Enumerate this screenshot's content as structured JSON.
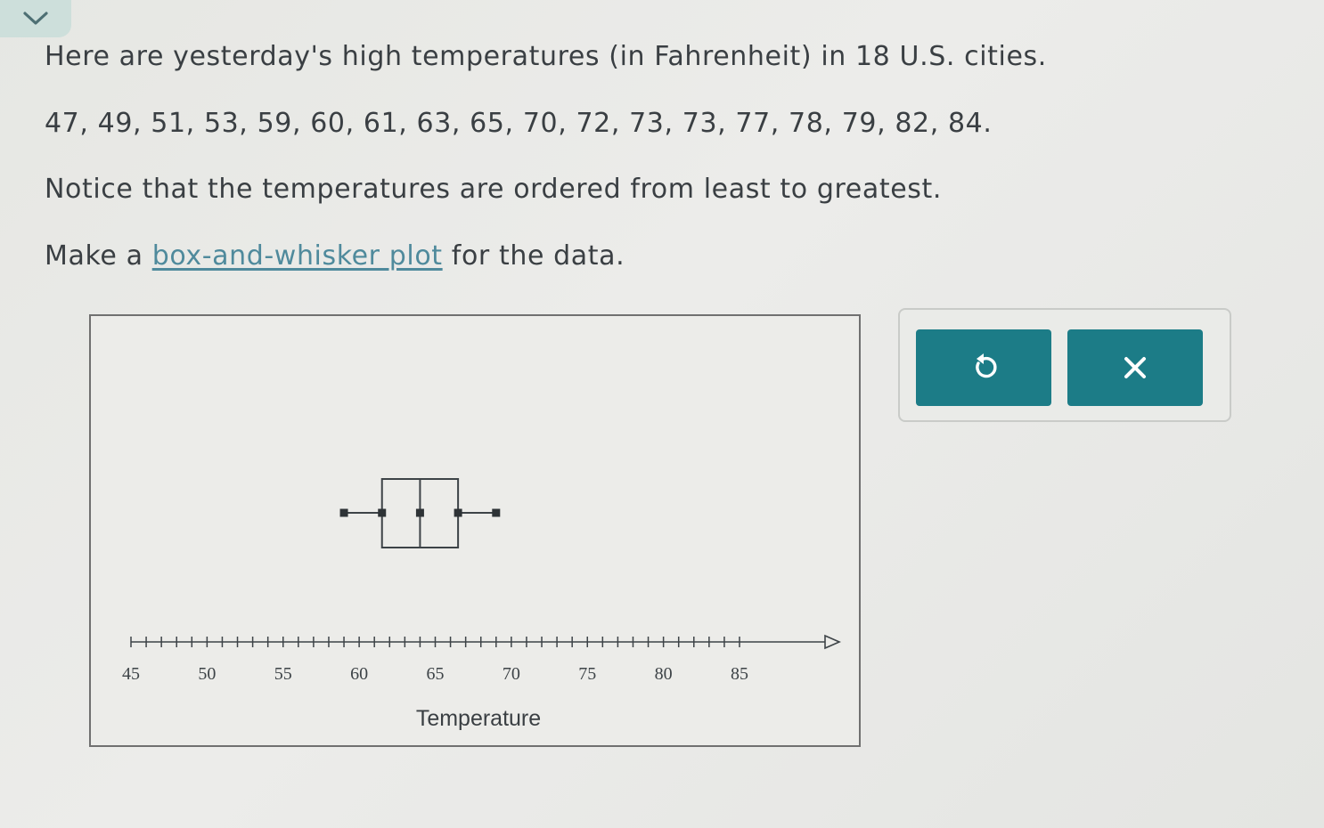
{
  "collapse": {
    "icon": "chevron-down-icon"
  },
  "question": {
    "line1": "Here are yesterday's high temperatures (in Fahrenheit) in 18 U.S. cities.",
    "data_line": "47, 49, 51, 53, 59, 60, 61, 63, 65, 70, 72, 73, 73, 77, 78, 79, 82, 84.",
    "notice": "Notice that the temperatures are ordered from least to greatest.",
    "instruction_prefix": "Make a ",
    "instruction_link": "box-and-whisker plot",
    "instruction_suffix": " for the data."
  },
  "chart_data": {
    "type": "box",
    "xlabel": "Temperature",
    "xlim": [
      45,
      85
    ],
    "tick_labels": [
      "45",
      "50",
      "55",
      "60",
      "65",
      "70",
      "75",
      "80",
      "85"
    ],
    "minor_tick_step": 1,
    "box": {
      "min": 59,
      "q1": 61.5,
      "median": 64,
      "q3": 66.5,
      "max": 69
    }
  },
  "tools": {
    "undo_icon": "undo-icon",
    "clear_icon": "close-icon",
    "accent_color": "#1c7c87"
  }
}
